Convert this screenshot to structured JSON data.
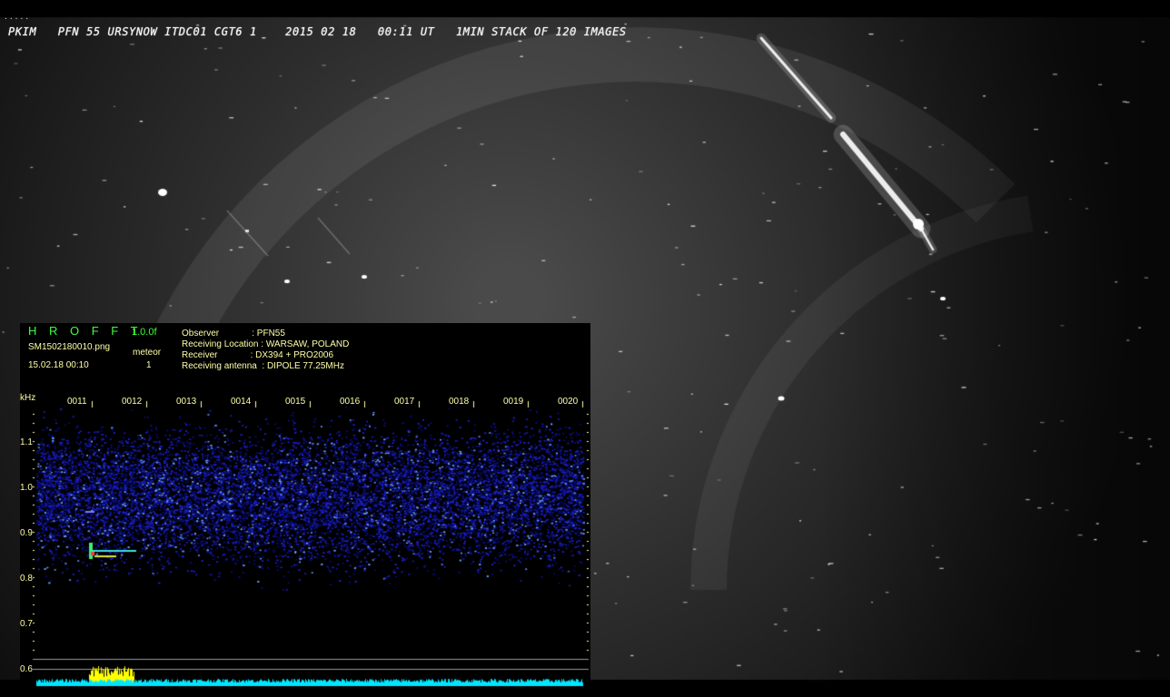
{
  "caption": "PKIM   PFN 55 URSYNOW ITDC01 CGT6 1    2015 02 18   00:11 UT   1MIN STACK OF 120 IMAGES",
  "corner_mark": ".....",
  "hro": {
    "title": "H R O F F T",
    "version": "1.0.0f",
    "filename": "SM1502180010.png",
    "datetime": "15.02.18 00:10",
    "meteor_label": "meteor",
    "meteor_count": "1",
    "info": [
      "Observer             : PFN55",
      "Receiving Location : WARSAW, POLAND",
      "Receiver             : DX394 + PRO2006",
      "Receiving antenna  : DIPOLE 77.25MHz"
    ],
    "y_unit": "kHz",
    "y_ticks": [
      "1.1",
      "1.0",
      "0.9",
      "0.8",
      "0.7",
      "0.6"
    ],
    "x_ticks": [
      "0011",
      "0012",
      "0013",
      "0014",
      "0015",
      "0016",
      "0017",
      "0018",
      "0019",
      "0020"
    ]
  }
}
